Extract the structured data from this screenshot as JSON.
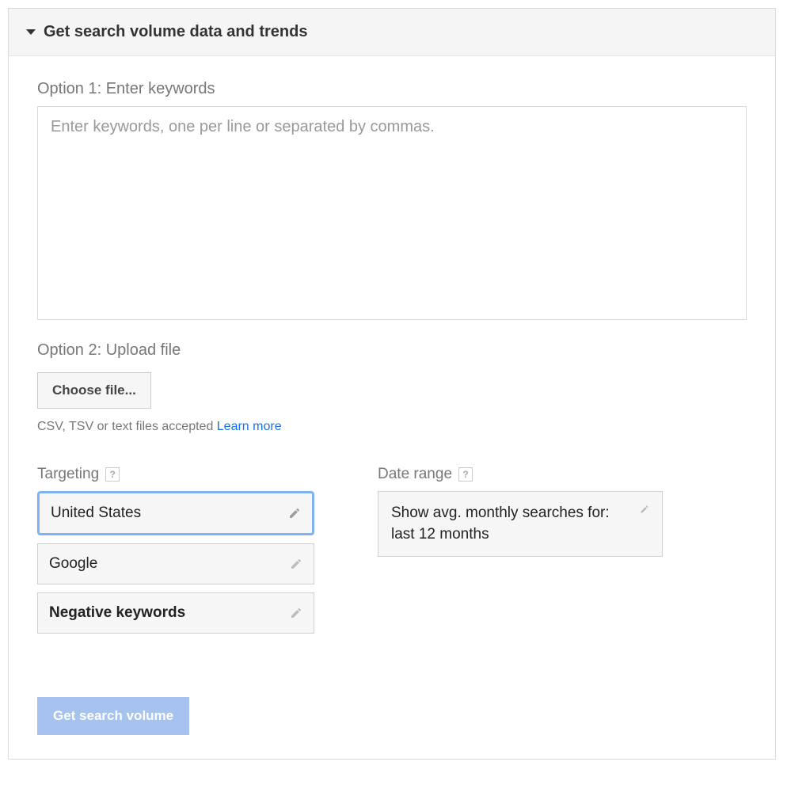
{
  "header": {
    "title": "Get search volume data and trends"
  },
  "option1": {
    "label": "Option 1: Enter keywords",
    "placeholder": "Enter keywords, one per line or separated by commas."
  },
  "option2": {
    "label": "Option 2: Upload file",
    "button": "Choose file...",
    "hint": "CSV, TSV or text files accepted ",
    "learnMore": "Learn more"
  },
  "targeting": {
    "heading": "Targeting",
    "items": [
      {
        "label": "United States",
        "active": true,
        "bold": false
      },
      {
        "label": "Google",
        "active": false,
        "bold": false
      },
      {
        "label": "Negative keywords",
        "active": false,
        "bold": true
      }
    ]
  },
  "dateRange": {
    "heading": "Date range",
    "text": "Show avg. monthly searches for: last 12 months"
  },
  "submit": {
    "label": "Get search volume"
  },
  "icons": {
    "help": "?"
  }
}
